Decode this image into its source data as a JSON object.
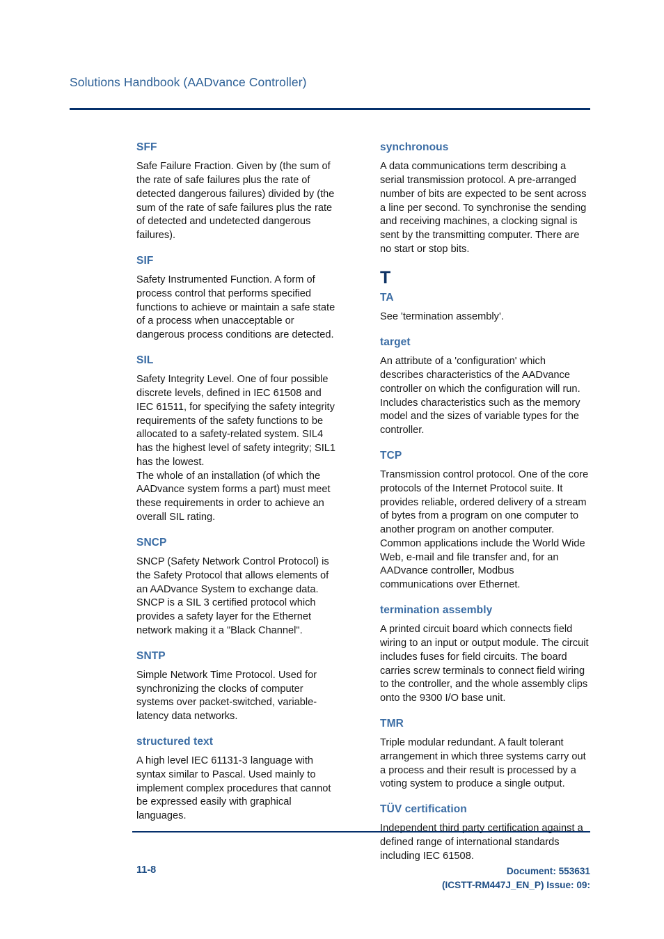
{
  "header": {
    "title": "Solutions Handbook (AADvance Controller)"
  },
  "colors": {
    "term_heading": "#3a6ca4",
    "section_letter": "#0d3264",
    "rule": "#05306b",
    "header_title": "#2d6096",
    "footer_text": "#1f4f86",
    "body_text": "#161616"
  },
  "glossary": {
    "left_column": [
      {
        "term": "SFF",
        "definition": "Safe Failure Fraction. Given by (the sum of the rate of safe failures plus the rate of detected dangerous failures) divided by (the sum of the rate of safe failures plus the rate of detected and undetected dangerous failures)."
      },
      {
        "term": "SIF",
        "definition": "Safety Instrumented Function. A form of process control that performs specified functions to achieve or maintain a safe state of a process when unacceptable or dangerous process conditions are detected."
      },
      {
        "term": "SIL",
        "definition": "Safety Integrity Level. One of four possible discrete levels, defined in IEC 61508 and IEC 61511, for specifying the safety integrity requirements of the safety functions to be allocated to a safety-related system. SIL4 has the highest level of safety integrity; SIL1 has the lowest.",
        "definition_2": "The whole of an installation (of which the AADvance system forms a part) must meet these requirements in order to achieve an overall SIL rating."
      },
      {
        "term": "SNCP",
        "definition": "SNCP (Safety Network Control Protocol) is the Safety Protocol that allows elements of an AADvance System to exchange data. SNCP is a SIL 3 certified protocol which provides a safety layer for the Ethernet network making it a \"Black Channel\"."
      },
      {
        "term": "SNTP",
        "definition": "Simple Network Time Protocol. Used for synchronizing the clocks of computer systems over packet-switched, variable-latency data networks."
      },
      {
        "term": "structured text",
        "definition": "A high level IEC 61131-3 language with syntax similar to Pascal. Used mainly to implement complex procedures that cannot be expressed easily with graphical languages."
      }
    ],
    "right_column": [
      {
        "term": "synchronous",
        "definition": "A data communications term describing a serial transmission protocol. A pre-arranged number of bits are expected to be sent across a line per second. To synchronise the sending and receiving machines, a clocking signal is sent by the transmitting computer. There are no start or stop bits."
      }
    ],
    "section_letter": "T",
    "right_column_after_letter": [
      {
        "term": "TA",
        "definition": "See 'termination assembly'."
      },
      {
        "term": "target",
        "definition": "An attribute of a 'configuration' which describes characteristics of the AADvance controller on which the configuration will run. Includes characteristics such as the memory model and the sizes of variable types for the controller."
      },
      {
        "term": "TCP",
        "definition": "Transmission control protocol. One of the core protocols of the Internet Protocol suite. It provides reliable, ordered delivery of a stream of bytes from a program on one computer to another program on another computer. Common applications include the World Wide Web, e-mail and file transfer and, for an AADvance controller, Modbus communications over Ethernet."
      },
      {
        "term": "termination assembly",
        "definition": "A printed circuit board which connects field wiring to an input or output module. The circuit includes fuses for field circuits. The board carries screw terminals to connect field wiring to the controller, and the whole assembly clips onto the 9300 I/O base unit."
      },
      {
        "term": "TMR",
        "definition": "Triple modular redundant. A fault tolerant arrangement in which three systems carry out a process and their result is processed by a voting system to produce a single output."
      },
      {
        "term": "TÜV certification",
        "definition": "Independent third party certification against a defined range of international standards including IEC 61508."
      }
    ]
  },
  "footer": {
    "page_number": "11-8",
    "document_line_1": "Document: 553631",
    "document_line_2": "(ICSTT-RM447J_EN_P) Issue: 09:"
  }
}
